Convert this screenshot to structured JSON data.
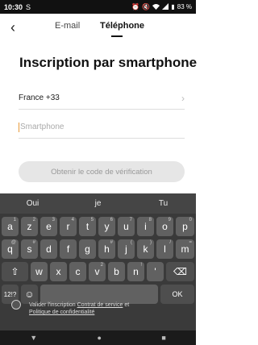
{
  "status": {
    "time": "10:30",
    "sim_icon": "s-icon",
    "battery": "83 %"
  },
  "nav": {
    "back_icon": "chevron-left-icon",
    "tab_email": "E-mail",
    "tab_phone": "Téléphone"
  },
  "page": {
    "title": "Inscription par smartphone"
  },
  "form": {
    "country_value": "France +33",
    "phone_placeholder": "Smartphone",
    "code_button": "Obtenir le code de vérification"
  },
  "consent": {
    "text_prefix": "Valider l'inscription",
    "link_contract": "Contrat de service",
    "text_mid": "et",
    "link_privacy": "Politique de confidentialité"
  },
  "keyboard": {
    "suggestions": [
      "Oui",
      "je",
      "Tu"
    ],
    "row1": [
      [
        "a",
        "1"
      ],
      [
        "z",
        "2"
      ],
      [
        "e",
        "3"
      ],
      [
        "r",
        "4"
      ],
      [
        "t",
        "5"
      ],
      [
        "y",
        "6"
      ],
      [
        "u",
        "7"
      ],
      [
        "i",
        "8"
      ],
      [
        "o",
        "9"
      ],
      [
        "p",
        "0"
      ]
    ],
    "row2": [
      [
        "q",
        "@"
      ],
      [
        "s",
        "#"
      ],
      [
        "d",
        ""
      ],
      [
        "f",
        ""
      ],
      [
        "g",
        ""
      ],
      [
        "h",
        "#"
      ],
      [
        "j",
        "("
      ],
      [
        "k",
        ")"
      ],
      [
        "l",
        "/"
      ],
      [
        "m",
        "="
      ]
    ],
    "row3": [
      [
        "w",
        ""
      ],
      [
        "x",
        ""
      ],
      [
        "c",
        ""
      ],
      [
        "v",
        "2"
      ],
      [
        "b",
        ""
      ],
      [
        "n",
        "!"
      ],
      [
        "'",
        ""
      ]
    ],
    "shift": "⇧",
    "delete": "⌫",
    "symbols": "12!?",
    "emoji": "☺",
    "ok": "OK"
  }
}
